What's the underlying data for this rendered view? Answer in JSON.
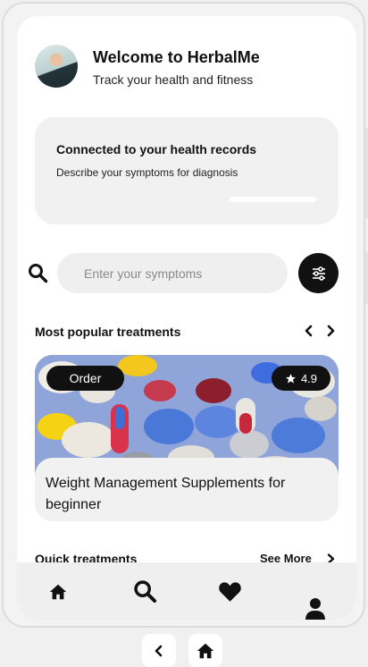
{
  "header": {
    "welcome": "Welcome to HerbalMe",
    "subtitle": "Track your health and fitness"
  },
  "records_card": {
    "title": "Connected to your health records",
    "description": "Describe your symptoms for diagnosis"
  },
  "search": {
    "placeholder": "Enter your symptoms"
  },
  "popular": {
    "title": "Most popular treatments",
    "cards": [
      {
        "badge": "Order",
        "rating": "4.9",
        "title": "Weight Management Supplements for beginner"
      }
    ]
  },
  "quick": {
    "title": "Quick treatments",
    "see_more": "See More"
  },
  "icons": {
    "search": "search-icon",
    "filter": "sliders-icon",
    "prev": "chevron-left-icon",
    "next": "chevron-right-icon",
    "star": "star-icon",
    "nav": [
      "home-icon",
      "search-icon",
      "heart-icon",
      "person-icon"
    ],
    "system": [
      "back-icon",
      "home-icon"
    ]
  },
  "colors": {
    "accent": "#111111",
    "card_bg": "#f1f1f1",
    "page_bg": "#f0f0f0"
  }
}
